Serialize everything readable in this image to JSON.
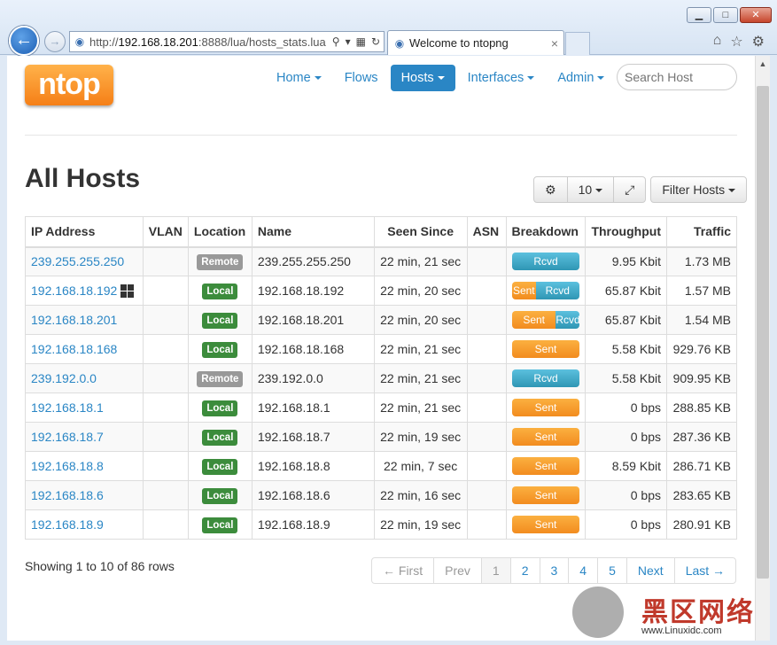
{
  "browser": {
    "url_prefix": "http://",
    "url_host": "192.168.18.201",
    "url_rest": ":8888/lua/hosts_stats.lua",
    "tab_title": "Welcome to ntopng",
    "tab_close": "×",
    "window_buttons": {
      "minimize": "▁",
      "maximize": "□",
      "close": "✕"
    }
  },
  "navbar": {
    "logo": "ntop",
    "items": [
      {
        "label": "Home",
        "dropdown": true
      },
      {
        "label": "Flows",
        "dropdown": false
      },
      {
        "label": "Hosts",
        "dropdown": true,
        "active": true
      },
      {
        "label": "Interfaces",
        "dropdown": true
      },
      {
        "label": "Admin",
        "dropdown": true
      }
    ],
    "search_placeholder": "Search Host"
  },
  "page": {
    "title": "All Hosts",
    "toolbar": {
      "page_size": "10",
      "filter": "Filter Hosts"
    }
  },
  "table": {
    "headers": [
      "IP Address",
      "VLAN",
      "Location",
      "Name",
      "Seen Since",
      "ASN",
      "Breakdown",
      "Throughput",
      "Traffic"
    ],
    "rows": [
      {
        "ip": "239.255.255.250",
        "vlan": "",
        "location": "Remote",
        "name": "239.255.255.250",
        "seen": "22 min, 21 sec",
        "asn": "",
        "sent": 0,
        "sent_label": "",
        "rcvd_label": "Rcvd",
        "throughput": "9.95 Kbit",
        "traffic": "1.73 MB",
        "os_icon": false
      },
      {
        "ip": "192.168.18.192",
        "vlan": "",
        "location": "Local",
        "name": "192.168.18.192",
        "seen": "22 min, 20 sec",
        "asn": "",
        "sent": 0.35,
        "sent_label": "Sent",
        "rcvd_label": "Rcvd",
        "throughput": "65.87 Kbit",
        "traffic": "1.57 MB",
        "os_icon": true
      },
      {
        "ip": "192.168.18.201",
        "vlan": "",
        "location": "Local",
        "name": "192.168.18.201",
        "seen": "22 min, 20 sec",
        "asn": "",
        "sent": 0.65,
        "sent_label": "Sent",
        "rcvd_label": "Rcvd",
        "throughput": "65.87 Kbit",
        "traffic": "1.54 MB",
        "os_icon": false
      },
      {
        "ip": "192.168.18.168",
        "vlan": "",
        "location": "Local",
        "name": "192.168.18.168",
        "seen": "22 min, 21 sec",
        "asn": "",
        "sent": 1,
        "sent_label": "Sent",
        "rcvd_label": "",
        "throughput": "5.58 Kbit",
        "traffic": "929.76 KB",
        "os_icon": false
      },
      {
        "ip": "239.192.0.0",
        "vlan": "",
        "location": "Remote",
        "name": "239.192.0.0",
        "seen": "22 min, 21 sec",
        "asn": "",
        "sent": 0,
        "sent_label": "",
        "rcvd_label": "Rcvd",
        "throughput": "5.58 Kbit",
        "traffic": "909.95 KB",
        "os_icon": false
      },
      {
        "ip": "192.168.18.1",
        "vlan": "",
        "location": "Local",
        "name": "192.168.18.1",
        "seen": "22 min, 21 sec",
        "asn": "",
        "sent": 1,
        "sent_label": "Sent",
        "rcvd_label": "",
        "throughput": "0 bps",
        "traffic": "288.85 KB",
        "os_icon": false
      },
      {
        "ip": "192.168.18.7",
        "vlan": "",
        "location": "Local",
        "name": "192.168.18.7",
        "seen": "22 min, 19 sec",
        "asn": "",
        "sent": 1,
        "sent_label": "Sent",
        "rcvd_label": "",
        "throughput": "0 bps",
        "traffic": "287.36 KB",
        "os_icon": false
      },
      {
        "ip": "192.168.18.8",
        "vlan": "",
        "location": "Local",
        "name": "192.168.18.8",
        "seen": "22 min, 7 sec",
        "asn": "",
        "sent": 1,
        "sent_label": "Sent",
        "rcvd_label": "",
        "throughput": "8.59 Kbit",
        "traffic": "286.71 KB",
        "os_icon": false
      },
      {
        "ip": "192.168.18.6",
        "vlan": "",
        "location": "Local",
        "name": "192.168.18.6",
        "seen": "22 min, 16 sec",
        "asn": "",
        "sent": 1,
        "sent_label": "Sent",
        "rcvd_label": "",
        "throughput": "0 bps",
        "traffic": "283.65 KB",
        "os_icon": false
      },
      {
        "ip": "192.168.18.9",
        "vlan": "",
        "location": "Local",
        "name": "192.168.18.9",
        "seen": "22 min, 19 sec",
        "asn": "",
        "sent": 1,
        "sent_label": "Sent",
        "rcvd_label": "",
        "throughput": "0 bps",
        "traffic": "280.91 KB",
        "os_icon": false
      }
    ]
  },
  "footer": {
    "showing": "Showing 1 to 10 of 86 rows",
    "pager": [
      {
        "label": "← First",
        "state": "disabled"
      },
      {
        "label": "Prev",
        "state": "disabled"
      },
      {
        "label": "1",
        "state": "current"
      },
      {
        "label": "2",
        "state": "link"
      },
      {
        "label": "3",
        "state": "link"
      },
      {
        "label": "4",
        "state": "link"
      },
      {
        "label": "5",
        "state": "link"
      },
      {
        "label": "Next",
        "state": "link"
      },
      {
        "label": "Last →",
        "state": "link"
      }
    ]
  },
  "watermark": {
    "brand": "黑区网络",
    "url": "www.Linuxidc.com"
  },
  "colors": {
    "accent": "#2a86c5",
    "sent": "#f28c1f",
    "rcvd": "#2f96b4",
    "local": "#3c8c3c",
    "remote": "#999999",
    "logo": "#f57f17"
  }
}
